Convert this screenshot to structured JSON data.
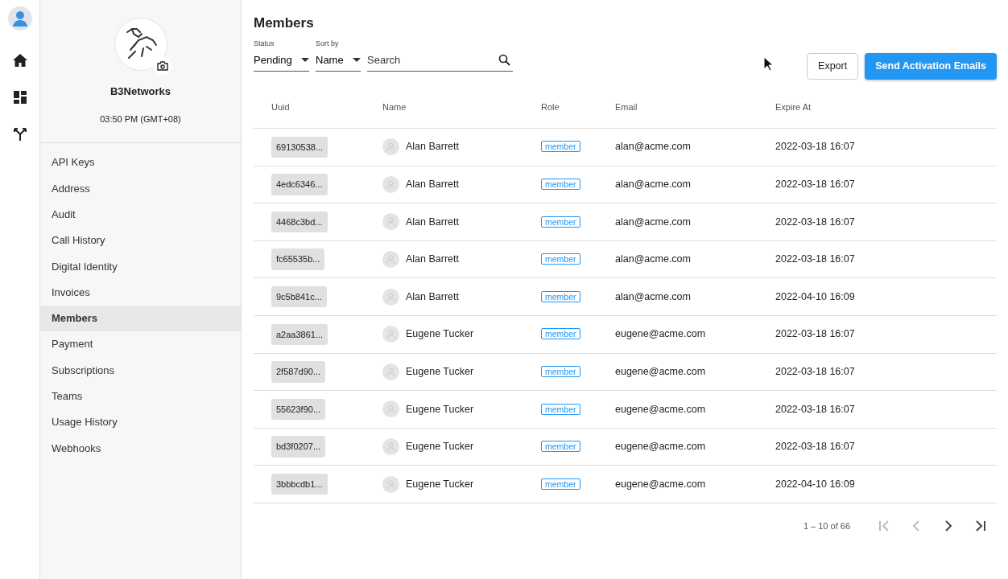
{
  "rail": {
    "items": [
      {
        "kind": "avatar",
        "selected": false
      },
      {
        "kind": "home",
        "selected": false
      },
      {
        "kind": "dashboard",
        "selected": false
      },
      {
        "kind": "fork",
        "selected": false
      }
    ]
  },
  "profile": {
    "name": "B3Networks",
    "time": "03:50 PM (GMT+08)"
  },
  "sidebar": {
    "items": [
      {
        "label": "API Keys",
        "selected": false
      },
      {
        "label": "Address",
        "selected": false
      },
      {
        "label": "Audit",
        "selected": false
      },
      {
        "label": "Call History",
        "selected": false
      },
      {
        "label": "Digital Identity",
        "selected": false
      },
      {
        "label": "Invoices",
        "selected": false
      },
      {
        "label": "Members",
        "selected": true
      },
      {
        "label": "Payment",
        "selected": false
      },
      {
        "label": "Subscriptions",
        "selected": false
      },
      {
        "label": "Teams",
        "selected": false
      },
      {
        "label": "Usage History",
        "selected": false
      },
      {
        "label": "Webhooks",
        "selected": false
      }
    ]
  },
  "page_title": "Members",
  "filters": {
    "status": {
      "label": "Status",
      "value": "Pending"
    },
    "sort": {
      "label": "Sort by",
      "value": "Name"
    },
    "search": {
      "placeholder": "Search"
    }
  },
  "buttons": [
    {
      "label": "Export",
      "kind": "outline"
    },
    {
      "label": "Send Activation Emails",
      "kind": "primary"
    }
  ],
  "table": {
    "columns": [
      "Uuid",
      "Name",
      "Role",
      "Email",
      "Expire At"
    ],
    "rows": [
      {
        "uuid": "69130538...",
        "name": "Alan Barrett",
        "role": "member",
        "email": "alan@acme.com",
        "expire": "2022-03-18 16:07"
      },
      {
        "uuid": "4edc6346...",
        "name": "Alan Barrett",
        "role": "member",
        "email": "alan@acme.com",
        "expire": "2022-03-18 16:07"
      },
      {
        "uuid": "4468c3bd...",
        "name": "Alan Barrett",
        "role": "member",
        "email": "alan@acme.com",
        "expire": "2022-03-18 16:07"
      },
      {
        "uuid": "fc65535b...",
        "name": "Alan Barrett",
        "role": "member",
        "email": "alan@acme.com",
        "expire": "2022-03-18 16:07"
      },
      {
        "uuid": "9c5b841c...",
        "name": "Alan Barrett",
        "role": "member",
        "email": "alan@acme.com",
        "expire": "2022-04-10 16:09"
      },
      {
        "uuid": "a2aa3861...",
        "name": "Eugene Tucker",
        "role": "member",
        "email": "eugene@acme.com",
        "expire": "2022-03-18 16:07"
      },
      {
        "uuid": "2f587d90...",
        "name": "Eugene Tucker",
        "role": "member",
        "email": "eugene@acme.com",
        "expire": "2022-03-18 16:07"
      },
      {
        "uuid": "55623f90...",
        "name": "Eugene Tucker",
        "role": "member",
        "email": "eugene@acme.com",
        "expire": "2022-03-18 16:07"
      },
      {
        "uuid": "bd3f0207...",
        "name": "Eugene Tucker",
        "role": "member",
        "email": "eugene@acme.com",
        "expire": "2022-03-18 16:07"
      },
      {
        "uuid": "3bbbcdb1...",
        "name": "Eugene Tucker",
        "role": "member",
        "email": "eugene@acme.com",
        "expire": "2022-04-10 16:09"
      }
    ]
  },
  "pagination": {
    "range": "1 – 10 of 66",
    "controls": [
      {
        "kind": "first",
        "disabled": true
      },
      {
        "kind": "prev",
        "disabled": true
      },
      {
        "kind": "next",
        "disabled": false
      },
      {
        "kind": "last",
        "disabled": false
      }
    ]
  }
}
